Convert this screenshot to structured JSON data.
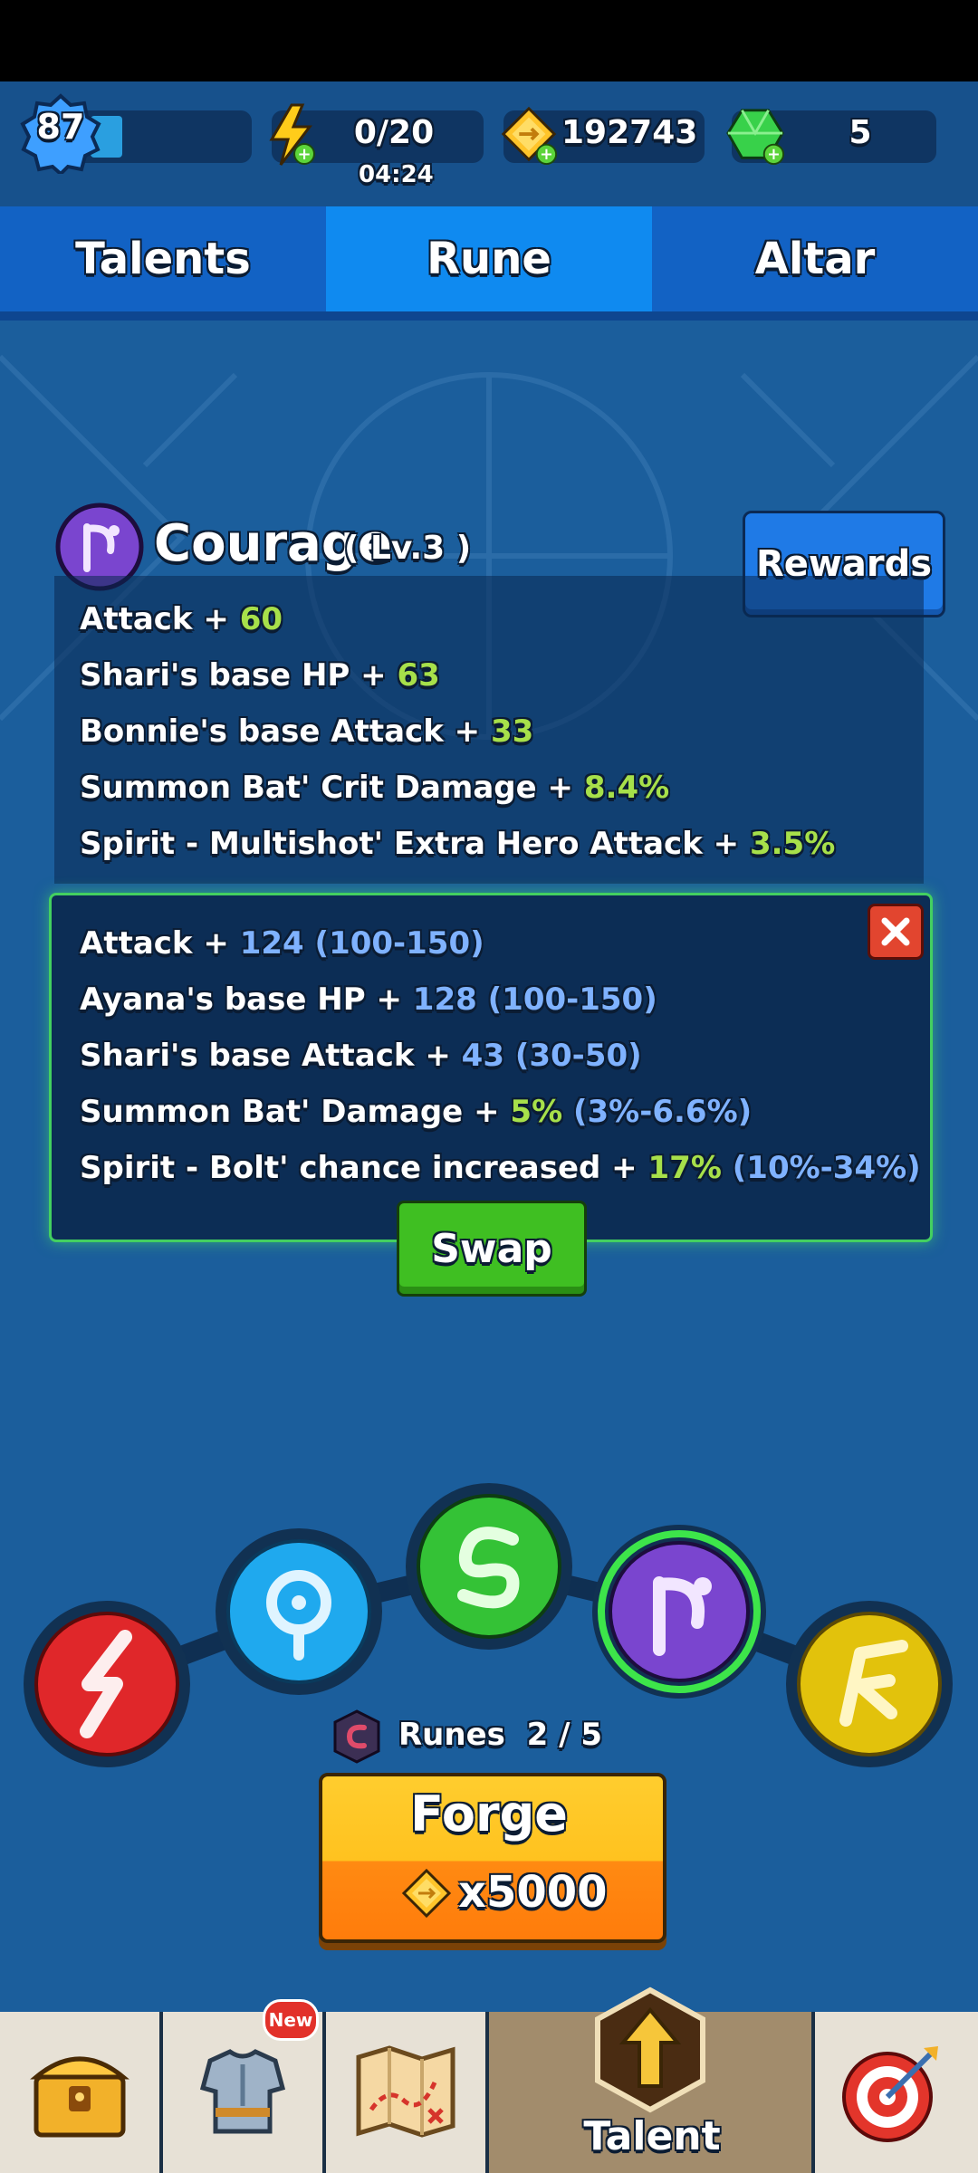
{
  "colors": {
    "background": "#1b5e9c",
    "tab_active": "#0f8af0",
    "stat_value_green": "#a7e04a",
    "stat_value_blue": "#7fb2ff",
    "swap_button": "#3fbf22",
    "forge_button": "#ffc21f"
  },
  "topbar": {
    "level": "87",
    "xp_progress": 0.2,
    "energy": "0/20",
    "energy_timer": "04:24",
    "gold": "192743",
    "gems": "5"
  },
  "tabs": [
    {
      "label": "Talents",
      "active": false
    },
    {
      "label": "Rune",
      "active": true
    },
    {
      "label": "Altar",
      "active": false
    }
  ],
  "rune": {
    "name": "Courage",
    "level": "( Lv.3 )",
    "rewards_label": "Rewards",
    "current_stats": [
      {
        "text": "Attack + ",
        "value": "60"
      },
      {
        "text": "Shari's base HP + ",
        "value": "63"
      },
      {
        "text": "Bonnie's base Attack + ",
        "value": "33"
      },
      {
        "text": "Summon Bat' Crit Damage + ",
        "value": "8.4%"
      },
      {
        "text": "Spirit - Multishot' Extra Hero Attack + ",
        "value": "3.5%"
      }
    ],
    "new_stats": [
      {
        "text": "Attack + ",
        "value": "124",
        "range": "(100-150)",
        "value_color": "blue"
      },
      {
        "text": "Ayana's base HP + ",
        "value": "128",
        "range": "(100-150)",
        "value_color": "blue"
      },
      {
        "text": "Shari's base Attack + ",
        "value": "43",
        "range": "(30-50)",
        "value_color": "blue"
      },
      {
        "text": "Summon Bat' Damage + ",
        "value": "5%",
        "range": "(3%-6.6%)",
        "value_color": "green"
      },
      {
        "text": "Spirit - Bolt' chance increased + ",
        "value": "17%",
        "range": "(10%-34%)",
        "value_color": "green"
      }
    ],
    "swap_label": "Swap"
  },
  "rune_slots": [
    {
      "name": "red-rune",
      "color": "#e0272a"
    },
    {
      "name": "blue-rune",
      "color": "#1fa9ee"
    },
    {
      "name": "green-rune",
      "color": "#34c236"
    },
    {
      "name": "purple-rune",
      "color": "#7a45cf",
      "selected": true
    },
    {
      "name": "yellow-rune",
      "color": "#e2c20c"
    }
  ],
  "forge": {
    "runes_label": "Runes",
    "runes_count": "2 / 5",
    "label": "Forge",
    "cost": "x5000"
  },
  "bottomnav": {
    "new_badge": "New",
    "talent_label": "Talent",
    "icons": [
      "treasure-chest-icon",
      "armor-icon",
      "map-icon",
      "talent-arrow-icon",
      "target-icon"
    ]
  }
}
